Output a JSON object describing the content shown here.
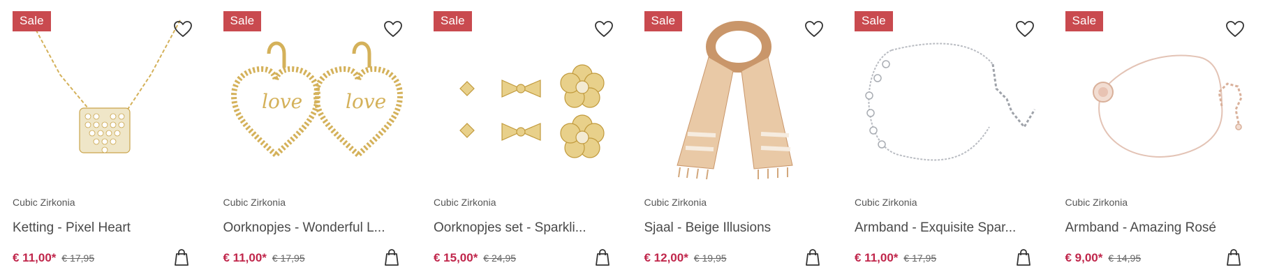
{
  "products": [
    {
      "badge": "Sale",
      "brand": "Cubic Zirkonia",
      "title": "Ketting - Pixel Heart",
      "price": "€ 11,00*",
      "old_price": "€ 17,95",
      "art": "necklace-heart"
    },
    {
      "badge": "Sale",
      "brand": "Cubic Zirkonia",
      "title": "Oorknopjes - Wonderful L...",
      "price": "€ 11,00*",
      "old_price": "€ 17,95",
      "art": "earrings-heart"
    },
    {
      "badge": "Sale",
      "brand": "Cubic Zirkonia",
      "title": "Oorknopjes set - Sparkli...",
      "price": "€ 15,00*",
      "old_price": "€ 24,95",
      "art": "stud-set"
    },
    {
      "badge": "Sale",
      "brand": "Cubic Zirkonia",
      "title": "Sjaal - Beige Illusions",
      "price": "€ 12,00*",
      "old_price": "€ 19,95",
      "art": "scarf"
    },
    {
      "badge": "Sale",
      "brand": "Cubic Zirkonia",
      "title": "Armband - Exquisite Spar...",
      "price": "€ 11,00*",
      "old_price": "€ 17,95",
      "art": "bracelet-silver"
    },
    {
      "badge": "Sale",
      "brand": "Cubic Zirkonia",
      "title": "Armband - Amazing Rosé",
      "price": "€ 9,00*",
      "old_price": "€ 14,95",
      "art": "bracelet-rose"
    }
  ],
  "icons": {
    "wishlist": "heart-outline-icon",
    "cart": "shopping-bag-icon"
  },
  "colors": {
    "sale_badge": "#c94a4f",
    "price": "#c0264b",
    "gold": "#d4b15a",
    "silver": "#b9bcc2",
    "rose": "#e3c3b5",
    "scarf": "#d7a77e"
  }
}
